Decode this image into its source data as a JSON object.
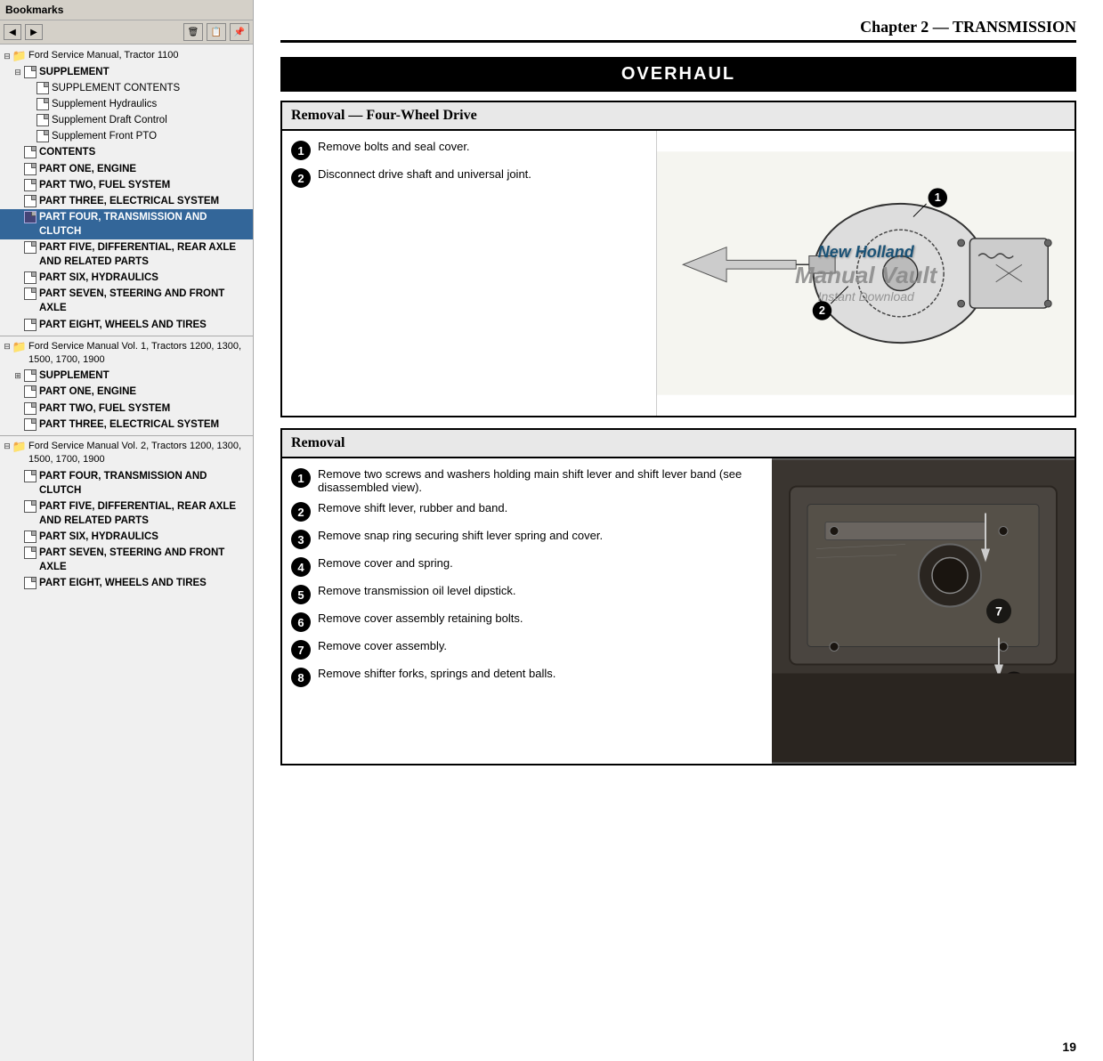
{
  "sidebar": {
    "header": "Bookmarks",
    "toolbar": {
      "back": "◀",
      "forward": "▶",
      "delete": "🗑",
      "copy": "📋",
      "paste": "📌"
    },
    "trees": [
      {
        "id": "tree1",
        "root": "Ford Service Manual, Tractor 1100",
        "expanded": true,
        "children": [
          {
            "label": "SUPPLEMENT",
            "bold": true,
            "expanded": true,
            "level": 1,
            "children": [
              {
                "label": "SUPPLEMENT CONTENTS",
                "level": 2
              },
              {
                "label": "Supplement Hydraulics",
                "level": 2
              },
              {
                "label": "Supplement Draft Control",
                "level": 2
              },
              {
                "label": "Supplement Front PTO",
                "level": 2
              }
            ]
          },
          {
            "label": "CONTENTS",
            "bold": true,
            "level": 1
          },
          {
            "label": "PART ONE, ENGINE",
            "bold": true,
            "level": 1
          },
          {
            "label": "PART TWO, FUEL SYSTEM",
            "bold": true,
            "level": 1
          },
          {
            "label": "PART THREE, ELECTRICAL SYSTEM",
            "bold": true,
            "level": 1
          },
          {
            "label": "PART FOUR, TRANSMISSION AND CLUTCH",
            "bold": true,
            "level": 1,
            "selected": true
          },
          {
            "label": "PART FIVE, DIFFERENTIAL, REAR AXLE AND RELATED PARTS",
            "bold": true,
            "level": 1
          },
          {
            "label": "PART SIX, HYDRAULICS",
            "bold": true,
            "level": 1
          },
          {
            "label": "PART SEVEN, STEERING AND FRONT AXLE",
            "bold": true,
            "level": 1
          },
          {
            "label": "PART EIGHT, WHEELS AND TIRES",
            "bold": true,
            "level": 1
          }
        ]
      },
      {
        "id": "tree2",
        "root": "Ford Service Manual Vol. 1, Tractors 1200, 1300, 1500, 1700, 1900",
        "expanded": true,
        "children": [
          {
            "label": "SUPPLEMENT",
            "bold": true,
            "level": 1,
            "expanded": true,
            "children": []
          },
          {
            "label": "PART ONE, ENGINE",
            "bold": true,
            "level": 1
          },
          {
            "label": "PART TWO, FUEL SYSTEM",
            "bold": true,
            "level": 1
          },
          {
            "label": "PART THREE, ELECTRICAL SYSTEM",
            "bold": true,
            "level": 1
          }
        ]
      },
      {
        "id": "tree3",
        "root": "Ford Service Manual Vol. 2, Tractors 1200, 1300, 1500, 1700, 1900",
        "expanded": true,
        "children": [
          {
            "label": "PART FOUR, TRANSMISSION AND CLUTCH",
            "bold": true,
            "level": 1
          },
          {
            "label": "PART FIVE, DIFFERENTIAL, REAR AXLE AND RELATED PARTS",
            "bold": true,
            "level": 1
          },
          {
            "label": "PART SIX, HYDRAULICS",
            "bold": true,
            "level": 1
          },
          {
            "label": "PART SEVEN, STEERING AND FRONT AXLE",
            "bold": true,
            "level": 1
          },
          {
            "label": "PART EIGHT, WHEELS AND TIRES",
            "bold": true,
            "level": 1
          }
        ]
      }
    ]
  },
  "main": {
    "chapter": "Chapter 2 — TRANSMISSION",
    "overhaul": "OVERHAUL",
    "section1": {
      "title": "Removal — Four-Wheel Drive",
      "steps": [
        {
          "num": "1",
          "text": "Remove bolts and seal cover."
        },
        {
          "num": "2",
          "text": "Disconnect drive shaft and universal joint."
        }
      ]
    },
    "section2": {
      "title": "Removal",
      "steps": [
        {
          "num": "1",
          "text": "Remove two screws and washers holding main shift lever and shift lever band (see disassembled view)."
        },
        {
          "num": "2",
          "text": "Remove shift lever, rubber and band."
        },
        {
          "num": "3",
          "text": "Remove snap ring securing shift lever spring and cover."
        },
        {
          "num": "4",
          "text": "Remove cover and spring."
        },
        {
          "num": "5",
          "text": "Remove transmission oil level dipstick."
        },
        {
          "num": "6",
          "text": "Remove cover assembly retaining bolts."
        },
        {
          "num": "7",
          "text": "Remove cover assembly."
        },
        {
          "num": "8",
          "text": "Remove shifter forks, springs and detent balls."
        }
      ]
    },
    "watermark": {
      "line1": "New Holland",
      "line2": "Manual Vault",
      "line3": "Instant Download"
    },
    "page_number": "19"
  }
}
